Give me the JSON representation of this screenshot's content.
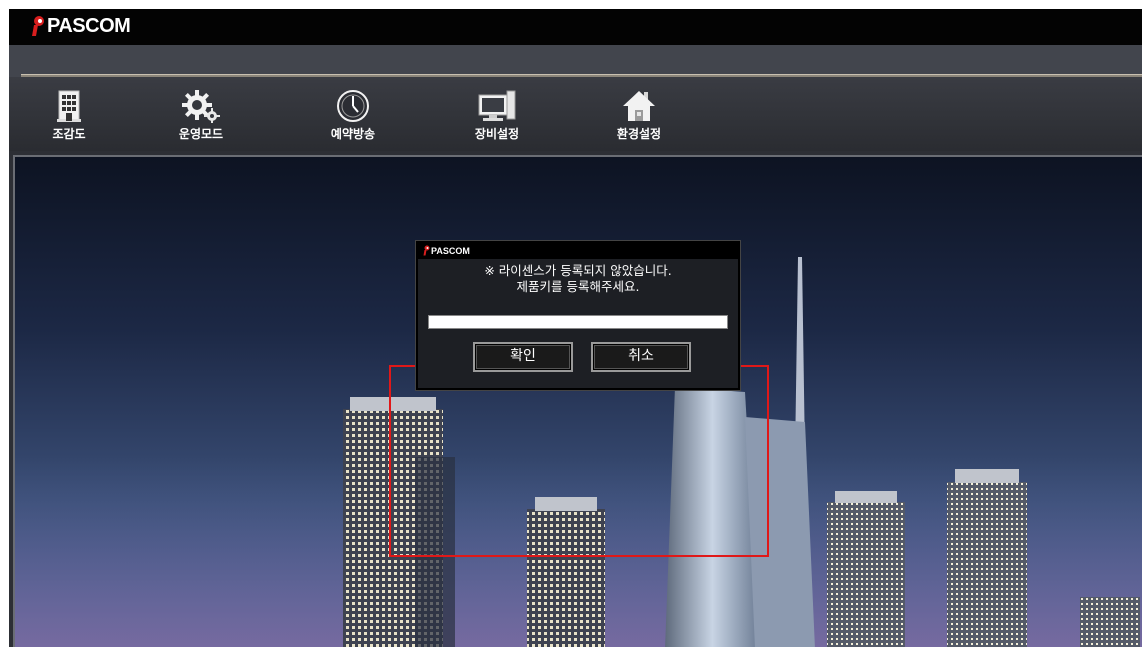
{
  "app": {
    "logo_text": "PASCOM",
    "brand_color": "#d81e1e"
  },
  "toolbar": {
    "items": [
      {
        "label": "조감도",
        "icon": "building-icon"
      },
      {
        "label": "운영모드",
        "icon": "gears-icon"
      },
      {
        "label": "예약방송",
        "icon": "clock-icon"
      },
      {
        "label": "장비설정",
        "icon": "computer-icon"
      },
      {
        "label": "환경설정",
        "icon": "home-icon"
      }
    ]
  },
  "dialog": {
    "logo_text": "PASCOM",
    "message_line1": "※ 라이센스가 등록되지 않았습니다.",
    "message_line2": "제품키를 등록해주세요.",
    "product_key_value": "",
    "ok_label": "확인",
    "cancel_label": "취소"
  },
  "colors": {
    "highlight_border": "#e01818",
    "titlebar": "#030303"
  }
}
